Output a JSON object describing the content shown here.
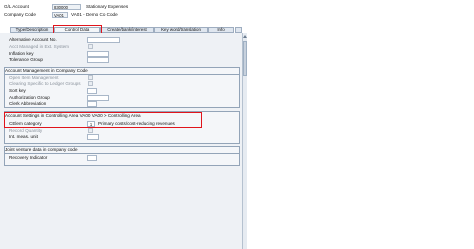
{
  "header": {
    "account_label": "G/L Account",
    "account_value": "830000",
    "account_desc": "Stationary Expenses",
    "company_label": "Company Code",
    "company_value": "VA01",
    "company_desc": "VA01 - Demo Co Code"
  },
  "tabs": [
    {
      "label": "Type/Description"
    },
    {
      "label": "Control Data"
    },
    {
      "label": "Create/bank/interest"
    },
    {
      "label": "Key word/translation"
    },
    {
      "label": "Info"
    }
  ],
  "top_fields": {
    "alt_account_label": "Alternative Account No.",
    "acct_managed_label": "Acct Managed in Ext. System",
    "inflation_label": "Inflation key",
    "tolerance_label": "Tolerance Group"
  },
  "account_mgmt": {
    "title": "Account Management in Company Code",
    "open_item_label": "Open Item Management",
    "clearing_label": "Clearing Specific to Ledger Groups",
    "sort_key_label": "Sort key",
    "auth_group_label": "Authorization Group",
    "clerk_label": "Clerk Abbreviation"
  },
  "account_settings": {
    "title": "Account Settings in Controlling Area VA00 VA00 > Controlling Area",
    "cost_category_label": "CElem category",
    "cost_category_value": "1",
    "cost_category_desc": "Primary costs/cost-reducing revenues",
    "record_qty_label": "Record Quantity",
    "int_meas_label": "Int. meas. unit"
  },
  "joint_venture": {
    "title": "Joint venture data in company code",
    "recovery_label": "Recovery Indicator"
  }
}
